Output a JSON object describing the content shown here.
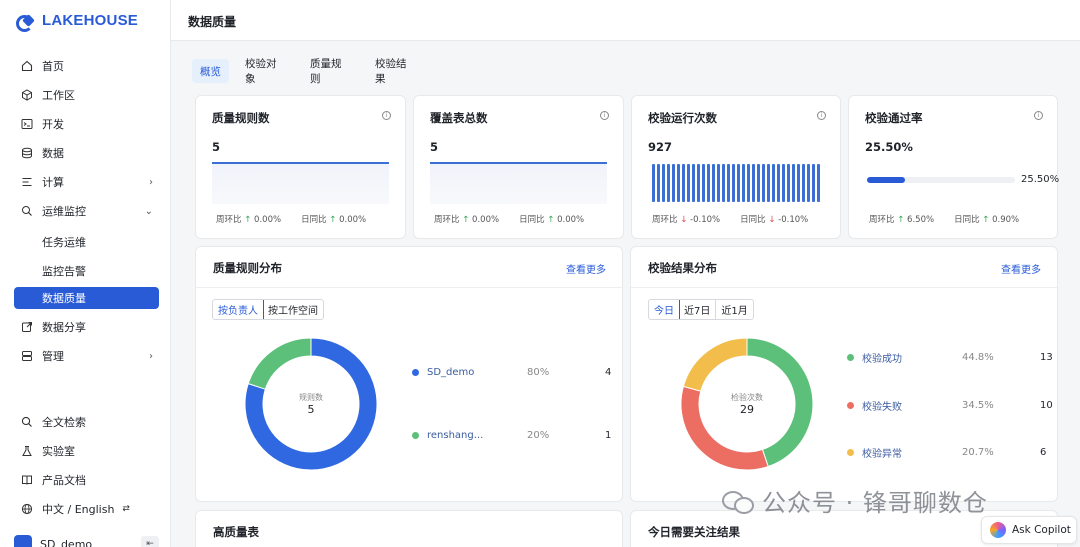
{
  "app": {
    "logo_text": "LAKEHOUSE",
    "page_title": "数据质量"
  },
  "sidebar": {
    "items": [
      {
        "label": "首页"
      },
      {
        "label": "工作区"
      },
      {
        "label": "开发"
      },
      {
        "label": "数据"
      },
      {
        "label": "计算"
      },
      {
        "label": "运维监控"
      },
      {
        "label": "任务运维"
      },
      {
        "label": "监控告警"
      },
      {
        "label": "数据质量"
      },
      {
        "label": "数据分享"
      },
      {
        "label": "管理"
      },
      {
        "label": "全文检索"
      },
      {
        "label": "实验室"
      },
      {
        "label": "产品文档"
      },
      {
        "label": "中文 / English"
      }
    ],
    "user": "SD_demo"
  },
  "tabs": [
    "概览",
    "校验对象",
    "质量规则",
    "校验结果"
  ],
  "stats": [
    {
      "title": "质量规则数",
      "value": "5",
      "wow_label": "周环比",
      "wow_value": "0.00%",
      "dod_label": "日同比",
      "dod_value": "0.00%"
    },
    {
      "title": "覆盖表总数",
      "value": "5",
      "wow_label": "周环比",
      "wow_value": "0.00%",
      "dod_label": "日同比",
      "dod_value": "0.00%"
    },
    {
      "title": "校验运行次数",
      "value": "927",
      "wow_label": "周环比",
      "wow_value": "-0.10%",
      "dod_label": "日同比",
      "dod_value": "-0.10%"
    },
    {
      "title": "校验通过率",
      "value": "25.50%",
      "progress_pct": 25.5,
      "progress_label": "25.50%",
      "wow_label": "周环比",
      "wow_value": "6.50%",
      "dod_label": "日同比",
      "dod_value": "0.90%"
    }
  ],
  "rule_dist": {
    "title": "质量规则分布",
    "see_more": "查看更多",
    "segments": [
      "按负责人",
      "按工作空间"
    ],
    "center_label": "规则数",
    "center_value": "5",
    "legend": [
      {
        "name": "SD_demo",
        "pct": "80%",
        "count": "4",
        "color": "#2f68e0"
      },
      {
        "name": "renshang...",
        "pct": "20%",
        "count": "1",
        "color": "#5cc07a"
      }
    ]
  },
  "result_dist": {
    "title": "校验结果分布",
    "see_more": "查看更多",
    "segments": [
      "今日",
      "近7日",
      "近1月"
    ],
    "center_label": "检验次数",
    "center_value": "29",
    "legend": [
      {
        "name": "校验成功",
        "pct": "44.8%",
        "count": "13",
        "color": "#5cc07a"
      },
      {
        "name": "校验失败",
        "pct": "34.5%",
        "count": "10",
        "color": "#ec6d62"
      },
      {
        "name": "校验异常",
        "pct": "20.7%",
        "count": "6",
        "color": "#f2bd4a"
      }
    ]
  },
  "bottom": {
    "left_title": "高质量表",
    "right_title": "今日需要关注结果"
  },
  "watermark": "公众号 · 锋哥聊数仓",
  "copilot": "Ask Copilot"
}
